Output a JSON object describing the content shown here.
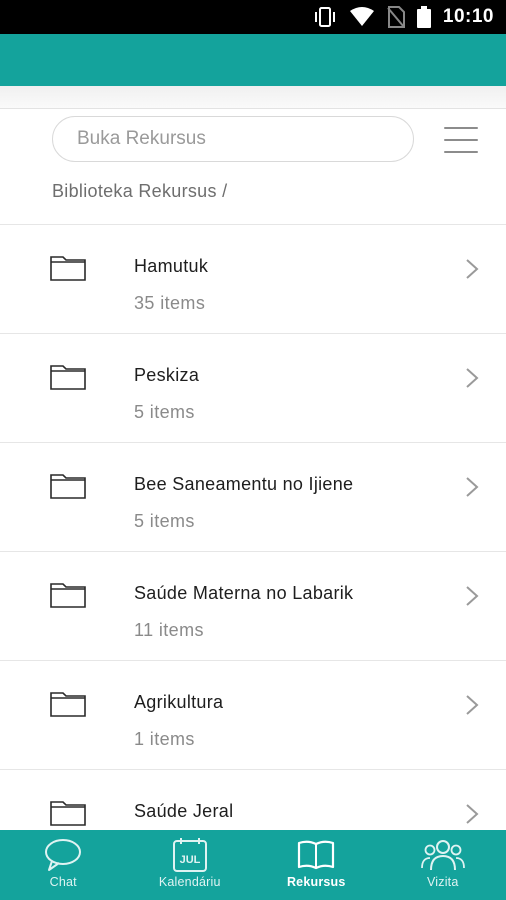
{
  "status_bar": {
    "time": "10:10"
  },
  "search": {
    "placeholder": "Buka Rekursus"
  },
  "breadcrumb": "Biblioteka Rekursus /",
  "folders": [
    {
      "title": "Hamutuk",
      "count": "35 items"
    },
    {
      "title": "Peskiza",
      "count": "5 items"
    },
    {
      "title": "Bee Saneamentu no Ijiene",
      "count": "5 items"
    },
    {
      "title": "Saúde Materna no Labarik",
      "count": "11 items"
    },
    {
      "title": "Agrikultura",
      "count": "1 items"
    },
    {
      "title": "Saúde Jeral",
      "count": ""
    }
  ],
  "nav": {
    "chat": "Chat",
    "calendar": "Kalendáriu",
    "calendar_icon_text": "JUL",
    "resources": "Rekursus",
    "visits": "Vizita",
    "active": "resources"
  },
  "colors": {
    "accent": "#14a39c"
  }
}
